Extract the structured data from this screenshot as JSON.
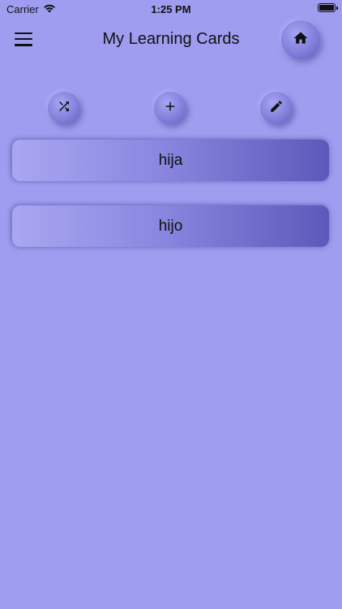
{
  "status_bar": {
    "carrier": "Carrier",
    "time": "1:25 PM"
  },
  "app_bar": {
    "title": "My Learning Cards",
    "menu_icon": "hamburger-menu-icon",
    "home_icon": "home-icon"
  },
  "toolbar": {
    "shuffle_icon": "shuffle-icon",
    "add_icon": "plus-icon",
    "edit_icon": "pencil-icon"
  },
  "cards": [
    {
      "label": "hija"
    },
    {
      "label": "hijo"
    }
  ],
  "colors": {
    "background": "#9f9def",
    "card_start": "#a9a7f1",
    "card_end": "#5c59ba"
  }
}
